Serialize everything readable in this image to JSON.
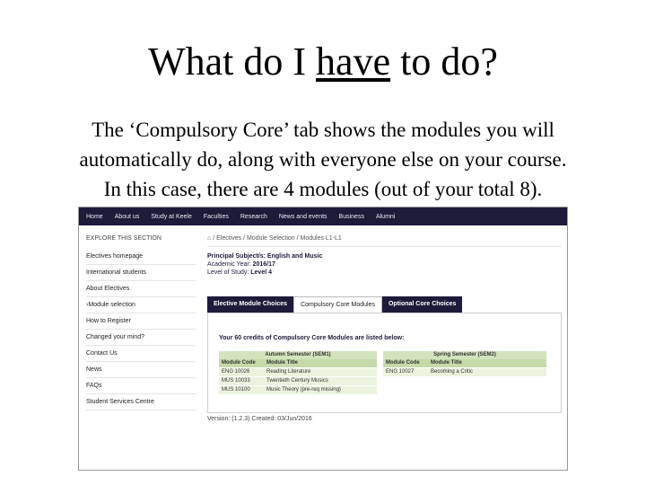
{
  "slide": {
    "title_pre": "What do I ",
    "title_u": "have",
    "title_post": " to do?",
    "line1": "The ‘Compulsory Core’ tab shows the modules you will",
    "line2": "automatically do, along with everyone else on your course.",
    "line3": "In this case, there are 4 modules (out of your total 8)."
  },
  "nav": [
    "Home",
    "About us",
    "Study at Keele",
    "Faculties",
    "Research",
    "News and events",
    "Business",
    "Alumni"
  ],
  "sidebar": {
    "heading": "EXPLORE THIS SECTION",
    "items": [
      "Electives homepage",
      "International students",
      "About Electives",
      "›Module selection",
      "How to Register",
      "Changed your mind?",
      "Contact Us",
      "News",
      "FAQs",
      "Student Services Centre"
    ]
  },
  "main": {
    "breadcrumb": "/ Electives / Module Selection / Modules L1-L1",
    "subjects_label": "Principal Subject/s:",
    "subjects_value": "English and Music",
    "year_label": "Academic Year:",
    "year_value": "2016/17",
    "level_label": "Level of Study:",
    "level_value": "Level 4",
    "tabs": [
      "Elective Module Choices",
      "Compulsory Core Modules",
      "Optional Core Choices"
    ],
    "intro": "Your 60 credits of Compulsory Core Modules are listed below:",
    "autumn": {
      "title": "Autumn Semester (SEM1)",
      "col_code": "Module Code",
      "col_title": "Module Title",
      "rows": [
        {
          "code": "ENG 10026",
          "title": "Reading Literature"
        },
        {
          "code": "MUS 10033",
          "title": "Twentieth Century Musics"
        },
        {
          "code": "MUS 10100",
          "title": "Music Theory (pre-req missing)"
        }
      ]
    },
    "spring": {
      "title": "Spring Semester (SEM2)",
      "col_code": "Module Code",
      "col_title": "Module Title",
      "rows": [
        {
          "code": "ENG 10027",
          "title": "Becoming a Critic"
        }
      ]
    },
    "version": "Version: (1.2.3) Created: 03/Jun/2016"
  }
}
